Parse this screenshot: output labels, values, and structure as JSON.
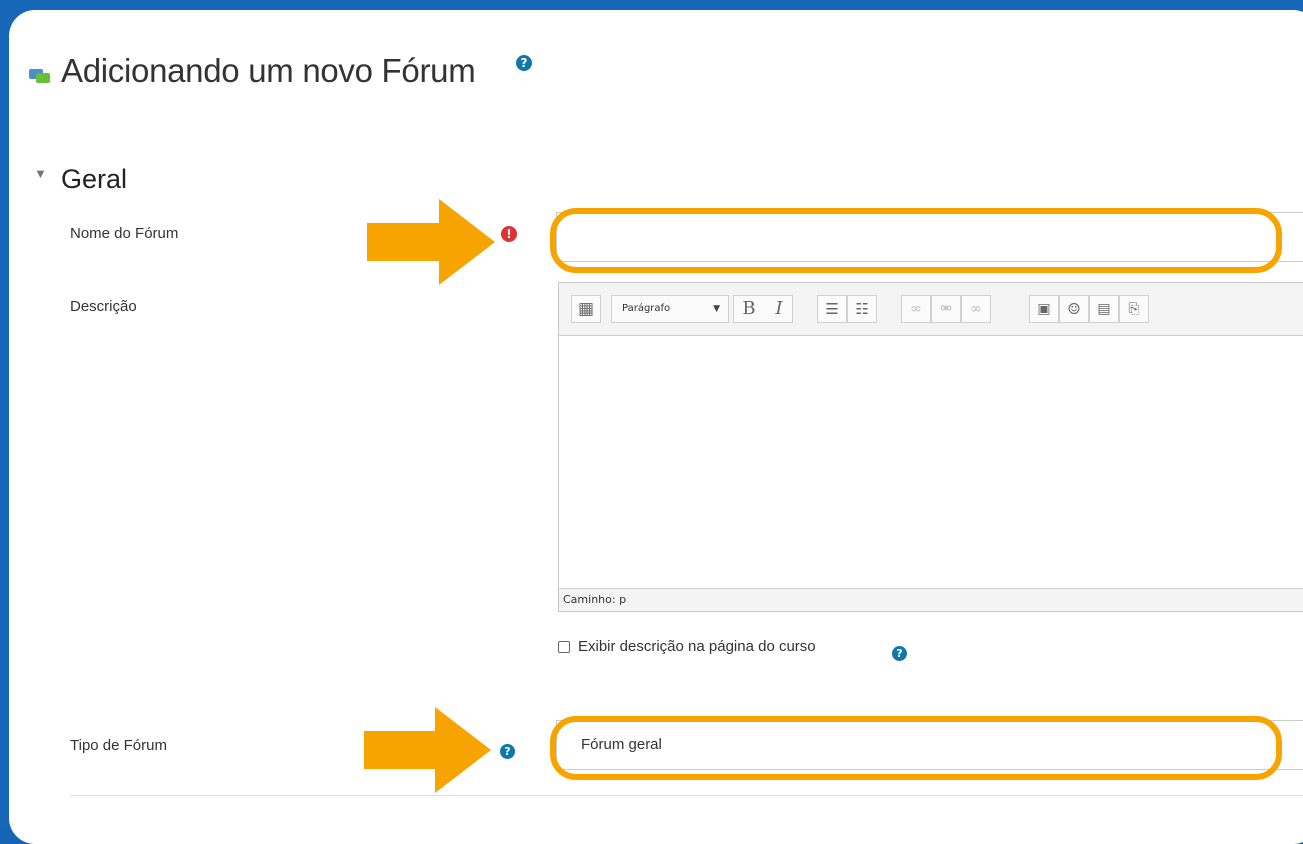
{
  "page": {
    "title": "Adicionando um novo Fórum",
    "title_help_icon": "help-icon"
  },
  "section": {
    "toggle_icon": "chevron-down-icon",
    "title": "Geral"
  },
  "fields": {
    "forum_name": {
      "label": "Nome do Fórum",
      "required_icon": "exclamation-icon",
      "value": ""
    },
    "description": {
      "label": "Descrição",
      "toolbar": {
        "format_select": "Parágrafo",
        "bold": "B",
        "italic": "I",
        "icons": [
          "toggle-toolbar-icon",
          "bullet-list-icon",
          "numbered-list-icon",
          "link-icon",
          "unlink-icon",
          "anchor-icon",
          "image-icon",
          "emoticon-icon",
          "media-icon",
          "paste-icon"
        ]
      },
      "path_label": "Caminho: p"
    },
    "show_description": {
      "label": "Exibir descrição na página do curso",
      "checked": false
    },
    "forum_type": {
      "label": "Tipo de Fórum",
      "value": "Fórum geral"
    }
  },
  "colors": {
    "frame": "#1667b8",
    "highlight": "#f7a400",
    "help": "#1177aa",
    "error": "#dd3333"
  }
}
